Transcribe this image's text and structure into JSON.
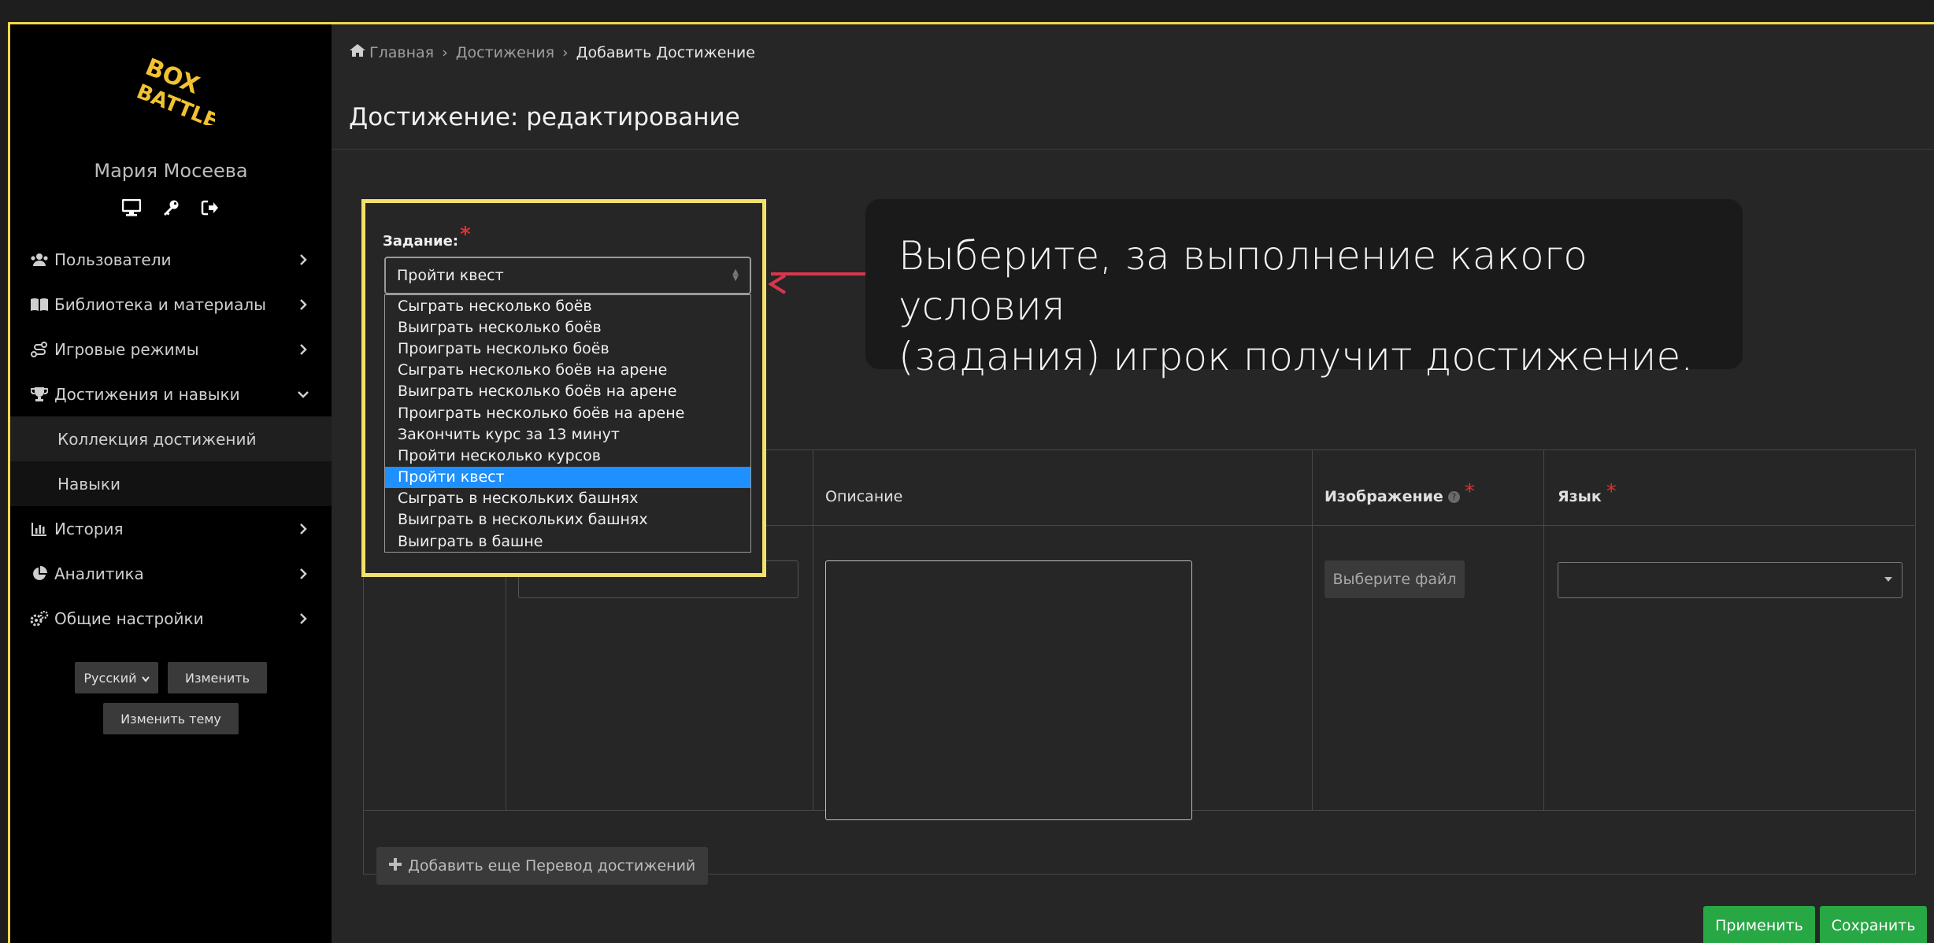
{
  "user": {
    "name": "Мария Мосеева"
  },
  "logo": {
    "text_line1": "BOX",
    "text_line2": "BATTLE"
  },
  "nav": {
    "items": [
      {
        "label": "Пользователи",
        "icon": "users-icon"
      },
      {
        "label": "Библиотека и материалы",
        "icon": "book-icon"
      },
      {
        "label": "Игровые режимы",
        "icon": "route-icon"
      },
      {
        "label": "Достижения и навыки",
        "icon": "trophy-icon",
        "expanded": true
      },
      {
        "label": "История",
        "icon": "chart-bar-icon"
      },
      {
        "label": "Аналитика",
        "icon": "pie-chart-icon"
      },
      {
        "label": "Общие настройки",
        "icon": "cogs-icon"
      }
    ],
    "sub_items": [
      {
        "label": "Коллекция достижений"
      },
      {
        "label": "Навыки"
      }
    ]
  },
  "sidebar_footer": {
    "language": "Русский",
    "change_label": "Изменить",
    "theme_label": "Изменить тему"
  },
  "breadcrumb": {
    "home": "Главная",
    "section": "Достижения",
    "current": "Добавить Достижение",
    "separator": "›"
  },
  "page": {
    "title": "Достижение: редактирование"
  },
  "task": {
    "label": "Задание:",
    "selected": "Пройти квест",
    "options": [
      "Сыграть несколько боёв",
      "Выиграть несколько боёв",
      "Проиграть несколько боёв",
      "Сыграть несколько боёв на арене",
      "Выиграть несколько боёв на арене",
      "Проиграть несколько боёв на арене",
      "Закончить курс за 13 минут",
      "Пройти несколько курсов",
      "Пройти квест",
      "Сыграть в нескольких башнях",
      "Выиграть в нескольких башнях",
      "Выиграть в башне"
    ]
  },
  "callout": {
    "line1": "Выберите, за выполнение какого условия",
    "line2": "(задания) игрок получит достижение."
  },
  "table": {
    "headers": {
      "description": "Описание",
      "image": "Изображение",
      "language": "Язык"
    },
    "file_button": "Выберите файл",
    "add_button": "Добавить еще Перевод достижений"
  },
  "actions": {
    "apply": "Применить",
    "save": "Сохранить"
  },
  "colors": {
    "accent": "#f2e16a",
    "green": "#28a745",
    "highlight": "#1e90ff",
    "arrow": "#d9364e"
  }
}
